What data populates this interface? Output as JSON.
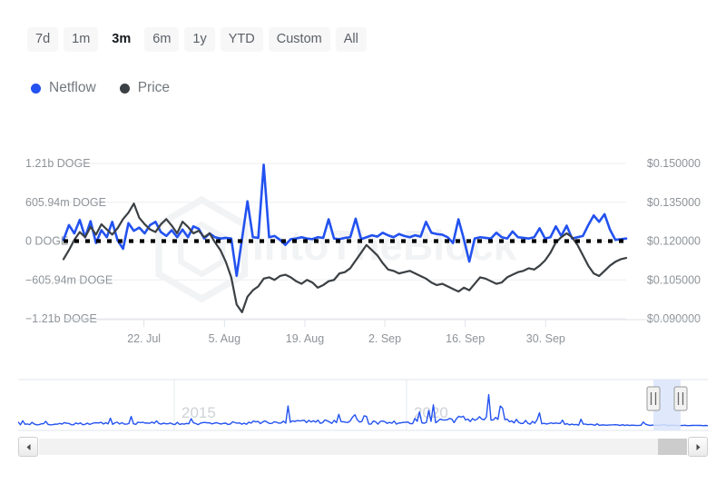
{
  "range_selector": {
    "name": "time-range-selector",
    "options": [
      {
        "label": "7d",
        "active": false
      },
      {
        "label": "1m",
        "active": false
      },
      {
        "label": "3m",
        "active": true
      },
      {
        "label": "6m",
        "active": false
      },
      {
        "label": "1y",
        "active": false
      },
      {
        "label": "YTD",
        "active": false
      },
      {
        "label": "Custom",
        "active": false
      },
      {
        "label": "All",
        "active": false
      }
    ],
    "selected": "3m"
  },
  "legend": {
    "items": [
      {
        "label": "Netflow",
        "color": "#2352f0",
        "icon": "legend-dot-icon"
      },
      {
        "label": "Price",
        "color": "#3b4044",
        "icon": "legend-dot-icon"
      }
    ]
  },
  "watermark": {
    "text": "IntoTheBlock",
    "logo_icon": "intotheblock-hexagon-logo-icon",
    "color": "#f2f3f4"
  },
  "navigator": {
    "year_labels": [
      "2015",
      "2020"
    ],
    "series_color": "#2352f0",
    "selection_color": "#dbe5fb",
    "handle_icon": "grip-handle-icon"
  },
  "scrollbar": {
    "left_arrow_icon": "scroll-left-arrow-icon",
    "right_arrow_icon": "scroll-right-arrow-icon",
    "thumb_name": "scrollbar-thumb"
  },
  "chart_data": {
    "type": "line",
    "title": "",
    "xlabel": "",
    "grid": true,
    "legend_position": "top-left",
    "x_tick_labels": [
      "22. Jul",
      "5. Aug",
      "19. Aug",
      "2. Sep",
      "16. Sep",
      "30. Sep"
    ],
    "x_tick_positions": [
      0.143,
      0.286,
      0.429,
      0.571,
      0.714,
      0.857
    ],
    "axes": [
      {
        "id": "left",
        "name": "netflow",
        "unit": "DOGE",
        "tick_labels": [
          "1.21b DOGE",
          "605.94m DOGE",
          "0 DOGE",
          "-605.94m DOGE",
          "-1.21b DOGE"
        ],
        "tick_values": [
          1210000000,
          605940000,
          0,
          -605940000,
          -1210000000
        ],
        "ylim": [
          -1210000000,
          1210000000
        ]
      },
      {
        "id": "right",
        "name": "price",
        "unit": "USD",
        "tick_labels": [
          "$0.150000",
          "$0.135000",
          "$0.120000",
          "$0.105000",
          "$0.090000"
        ],
        "tick_values": [
          0.15,
          0.135,
          0.12,
          0.105,
          0.09
        ],
        "ylim": [
          0.09,
          0.15
        ]
      }
    ],
    "zero_line": {
      "value": 0,
      "style": "dotted",
      "color": "#000000"
    },
    "series": [
      {
        "name": "Netflow",
        "axis": "left",
        "color": "#2352f0",
        "values": [
          20000000,
          250000000,
          120000000,
          330000000,
          60000000,
          310000000,
          -30000000,
          170000000,
          60000000,
          300000000,
          10000000,
          -120000000,
          280000000,
          160000000,
          210000000,
          120000000,
          250000000,
          300000000,
          140000000,
          80000000,
          170000000,
          60000000,
          180000000,
          60000000,
          230000000,
          190000000,
          40000000,
          120000000,
          60000000,
          40000000,
          50000000,
          40000000,
          -540000000,
          40000000,
          620000000,
          60000000,
          50000000,
          1190000000,
          60000000,
          80000000,
          20000000,
          -60000000,
          30000000,
          40000000,
          60000000,
          40000000,
          30000000,
          60000000,
          50000000,
          340000000,
          40000000,
          30000000,
          50000000,
          60000000,
          350000000,
          30000000,
          60000000,
          90000000,
          70000000,
          130000000,
          90000000,
          60000000,
          110000000,
          80000000,
          60000000,
          90000000,
          70000000,
          300000000,
          130000000,
          110000000,
          100000000,
          60000000,
          -30000000,
          340000000,
          30000000,
          -320000000,
          40000000,
          60000000,
          50000000,
          40000000,
          130000000,
          60000000,
          40000000,
          150000000,
          60000000,
          50000000,
          40000000,
          60000000,
          200000000,
          40000000,
          60000000,
          230000000,
          80000000,
          240000000,
          40000000,
          60000000,
          80000000,
          250000000,
          400000000,
          300000000,
          420000000,
          180000000,
          20000000,
          30000000,
          40000000
        ]
      },
      {
        "name": "Price",
        "axis": "right",
        "color": "#3b4044",
        "values": [
          0.113,
          0.1165,
          0.1205,
          0.1235,
          0.1215,
          0.1255,
          0.1225,
          0.1265,
          0.1245,
          0.1225,
          0.125,
          0.1285,
          0.131,
          0.1345,
          0.129,
          0.1265,
          0.1245,
          0.1235,
          0.1265,
          0.1285,
          0.126,
          0.123,
          0.1275,
          0.1255,
          0.123,
          0.124,
          0.1215,
          0.123,
          0.1195,
          0.1165,
          0.112,
          0.106,
          0.0955,
          0.0925,
          0.0985,
          0.101,
          0.1025,
          0.1055,
          0.106,
          0.105,
          0.1065,
          0.107,
          0.106,
          0.1045,
          0.1035,
          0.105,
          0.104,
          0.102,
          0.103,
          0.1045,
          0.105,
          0.1075,
          0.108,
          0.1095,
          0.1125,
          0.1155,
          0.1185,
          0.1165,
          0.1145,
          0.1115,
          0.109,
          0.1085,
          0.1075,
          0.108,
          0.1085,
          0.1075,
          0.1065,
          0.1055,
          0.104,
          0.103,
          0.1035,
          0.1025,
          0.1015,
          0.1005,
          0.102,
          0.101,
          0.1035,
          0.106,
          0.1055,
          0.1045,
          0.1035,
          0.104,
          0.106,
          0.107,
          0.108,
          0.1085,
          0.1095,
          0.109,
          0.1105,
          0.1125,
          0.1155,
          0.1195,
          0.1215,
          0.123,
          0.1215,
          0.1185,
          0.1145,
          0.1105,
          0.1075,
          0.1065,
          0.1085,
          0.1105,
          0.112,
          0.113,
          0.1135
        ]
      }
    ]
  }
}
